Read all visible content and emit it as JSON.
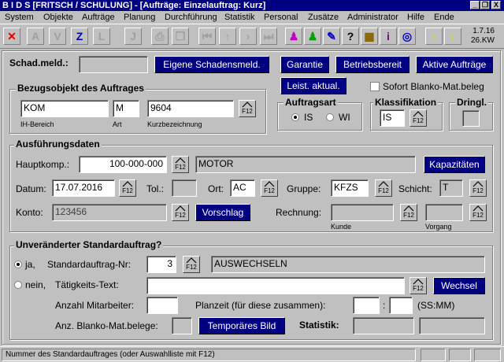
{
  "window": {
    "title": "B I D S  [FRITSCH / SCHULUNG] - [Aufträge: Einzelauftrag: Kurz]",
    "min": "_",
    "restore": "❐",
    "close": "X"
  },
  "menu": [
    "System",
    "Objekte",
    "Aufträge",
    "Planung",
    "Durchführung",
    "Statistik",
    "Personal",
    "Zusätze",
    "Administrator",
    "Hilfe",
    "Ende"
  ],
  "toolbar": {
    "version": "1.7.16",
    "kw": "26.KW"
  },
  "schad": {
    "label": "Schad.meld.:",
    "value": "",
    "btn": "Eigene Schadensmeld."
  },
  "buttons": {
    "garantie": "Garantie",
    "betriebsbereit": "Betriebsbereit",
    "aktive": "Aktive Aufträge",
    "leist": "Leist. aktual."
  },
  "sofort": {
    "label": "Sofort Blanko-Mat.beleg"
  },
  "bezug": {
    "header": "Bezugsobjekt des Auftrages",
    "ih_value": "KOM",
    "art_value": "M",
    "kurz_value": "9604",
    "ih_label": "IH-Bereich",
    "art_label": "Art",
    "kurz_label": "Kurzbezeichnung"
  },
  "auftragsart": {
    "header": "Auftragsart",
    "is": "IS",
    "wi": "WI"
  },
  "klass": {
    "header": "Klassifikation",
    "value": "IS"
  },
  "dringl": {
    "header": "Dringl."
  },
  "f12": "F12",
  "ausf": {
    "header": "Ausführungsdaten",
    "hauptkomp_label": "Hauptkomp.:",
    "hauptkomp_value": "100-000-000",
    "hauptkomp_text": "MOTOR",
    "kapazitaeten": "Kapazitäten",
    "datum_label": "Datum:",
    "datum_value": "17.07.2016",
    "tol_label": "Tol.:",
    "ort_label": "Ort:",
    "ort_value": "AC",
    "gruppe_label": "Gruppe:",
    "gruppe_value": "KFZS",
    "schicht_label": "Schicht:",
    "schicht_value": "T",
    "konto_label": "Konto:",
    "konto_value": "123456",
    "vorschlag": "Vorschlag",
    "rechnung_label": "Rechnung:",
    "kunde_label": "Kunde",
    "vorgang_label": "Vorgang"
  },
  "std": {
    "header": "Unveränderter Standardauftrag?",
    "ja": "ja,",
    "std_label": "Standardauftrag-Nr:",
    "std_value": "3",
    "std_text": "AUSWECHSELN",
    "nein": "nein,",
    "taet_label": "Tätigkeits-Text:",
    "wechsel": "Wechsel",
    "anzahl_label": "Anzahl Mitarbeiter:",
    "planzeit_label": "Planzeit (für diese zusammen):",
    "colon": ":",
    "sshmm": "(SS:MM)",
    "blanko_label": "Anz. Blanko-Mat.belege:",
    "temp": "Temporäres Bild",
    "statistik": "Statistik:"
  },
  "status": {
    "text": "Nummer des Standardauftrages (oder Auswahlliste mit F12)"
  }
}
